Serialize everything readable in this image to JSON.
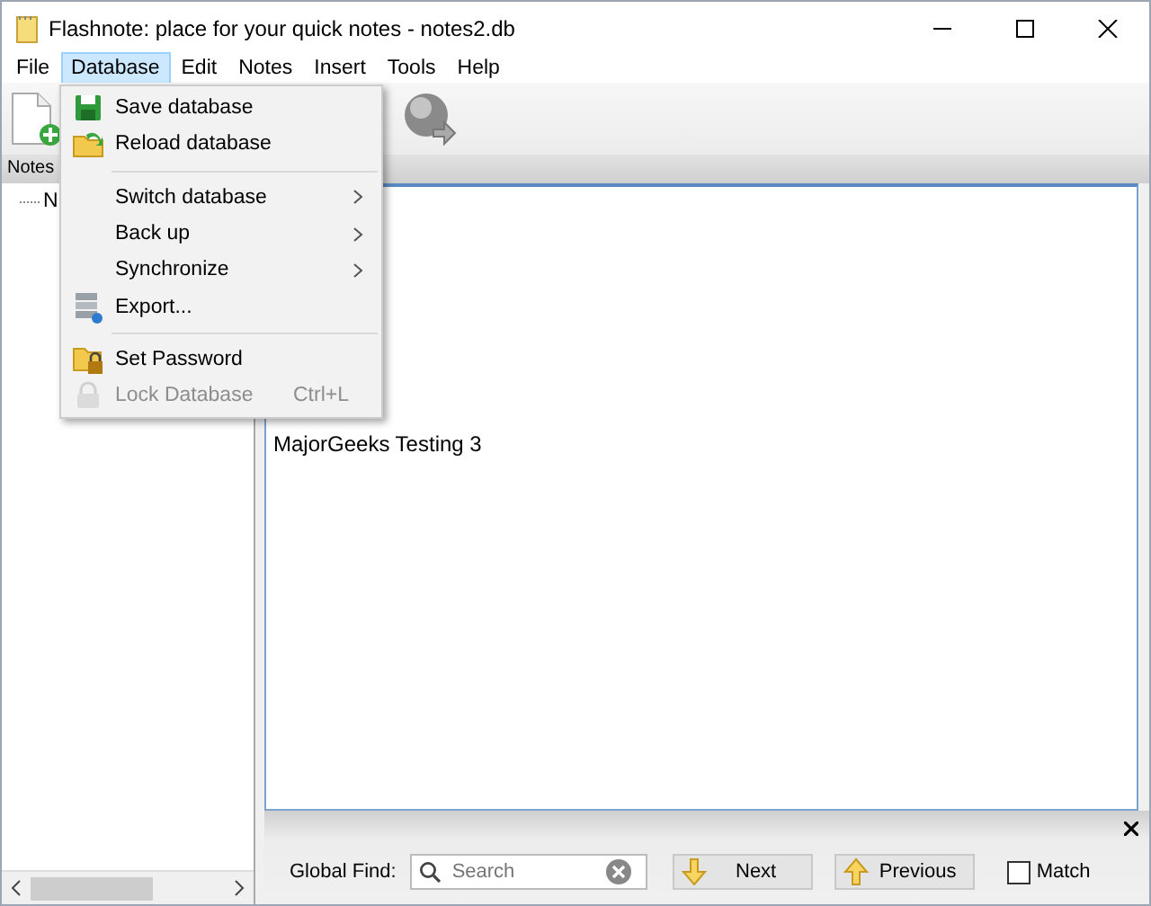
{
  "window": {
    "title": "Flashnote: place for your quick notes - notes2.db"
  },
  "menu_bar": [
    {
      "label": "File",
      "selected": false
    },
    {
      "label": "Database",
      "selected": true
    },
    {
      "label": "Edit",
      "selected": false
    },
    {
      "label": "Notes",
      "selected": false
    },
    {
      "label": "Insert",
      "selected": false
    },
    {
      "label": "Tools",
      "selected": false
    },
    {
      "label": "Help",
      "selected": false
    }
  ],
  "database_menu": [
    {
      "kind": "item",
      "label": "Save database",
      "disabled": false,
      "submenu": false
    },
    {
      "kind": "item",
      "label": "Reload database",
      "disabled": false,
      "submenu": false
    },
    {
      "kind": "separator"
    },
    {
      "kind": "item",
      "label": "Switch database",
      "disabled": false,
      "submenu": true
    },
    {
      "kind": "item",
      "label": "Back up",
      "disabled": false,
      "submenu": true
    },
    {
      "kind": "item",
      "label": "Synchronize",
      "disabled": false,
      "submenu": true
    },
    {
      "kind": "item",
      "label": "Export...",
      "disabled": false,
      "submenu": false
    },
    {
      "kind": "separator"
    },
    {
      "kind": "item",
      "label": "Set Password",
      "disabled": false,
      "submenu": false
    },
    {
      "kind": "item",
      "label": "Lock Database",
      "disabled": true,
      "submenu": false,
      "shortcut": "Ctrl+L"
    }
  ],
  "notes_pane": {
    "header": "Notes",
    "tree": [
      {
        "label": "N"
      }
    ]
  },
  "editor": {
    "text": "MajorGeeks Testing 3"
  },
  "find_bar": {
    "label": "Global Find:",
    "placeholder": "Search",
    "next": "Next",
    "previous": "Previous",
    "match": {
      "label": "Match",
      "checked": false
    }
  }
}
